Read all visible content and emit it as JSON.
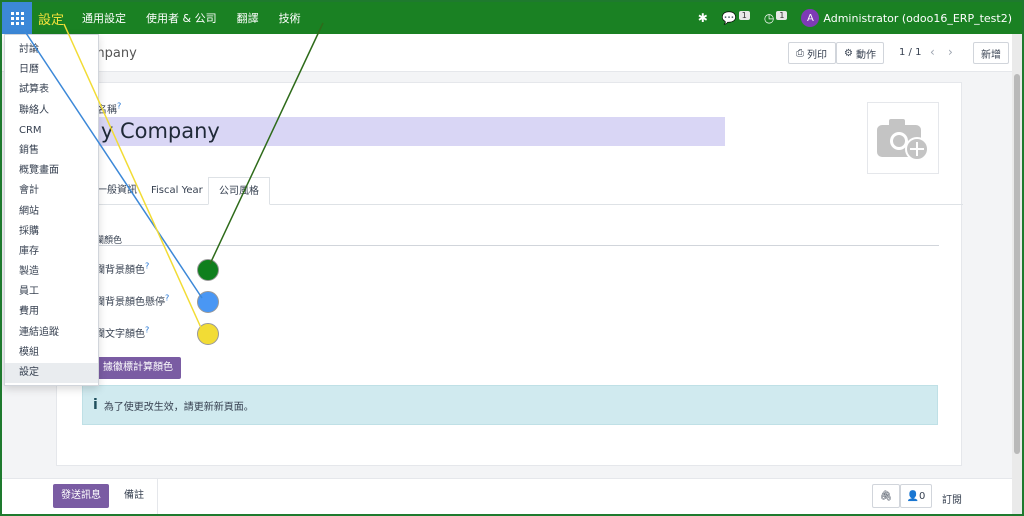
{
  "navbar": {
    "brand": "設定",
    "menu": [
      "通用設定",
      "使用者 & 公司",
      "翻譯",
      "技術"
    ],
    "messages_count": "1",
    "activities_count": "1",
    "avatar_letter": "A",
    "user_label": "Administrator (odoo16_ERP_test2)"
  },
  "control": {
    "breadcrumb": "mpany",
    "print_label": "列印",
    "action_label": "動作",
    "pager": "1 / 1",
    "new_label": "新增"
  },
  "form": {
    "name_label": "名稱",
    "name_label_help": "?",
    "name_value": "ly Company",
    "tabs": [
      "一般資訊",
      "Fiscal Year",
      "公司風格"
    ],
    "section_title": "欄顏色",
    "rows": [
      {
        "label": "欄背景顏色",
        "help": "?",
        "color": "#0f7f1d"
      },
      {
        "label": "欄背景顏色懸停",
        "help": "?",
        "color": "#4a97f4"
      },
      {
        "label": "欄文字顏色",
        "help": "?",
        "color": "#f2dc35"
      }
    ],
    "compute_label": "據徽標計算顏色",
    "alert_text": "為了使更改生效，請更新新頁面。"
  },
  "chatter": {
    "send_label": "發送訊息",
    "note_label": "備註",
    "followers_count": "0",
    "follow_label": "訂閱"
  },
  "apps_menu": {
    "items": [
      "討論",
      "日曆",
      "試算表",
      "聯絡人",
      "CRM",
      "銷售",
      "概覽畫面",
      "會計",
      "網站",
      "採購",
      "庫存",
      "製造",
      "員工",
      "費用",
      "連結追蹤",
      "模組",
      "設定"
    ],
    "active": "設定"
  },
  "colors": {
    "navbar": "#1a8123",
    "brand": "#f2e23c",
    "apps_button": "#3c88d8",
    "primary_button": "#7a5ca3",
    "avatar": "#7e3ab5",
    "line_green": "#2e6b1a",
    "line_blue": "#3c88d8",
    "line_yellow": "#f2dc35"
  }
}
